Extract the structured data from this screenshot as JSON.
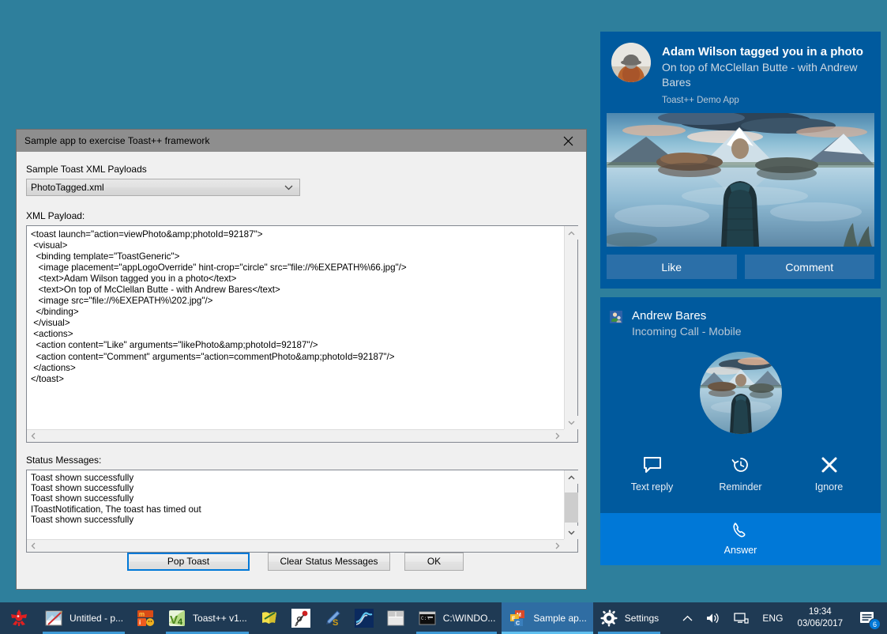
{
  "desktop": {
    "background": "#2e7f9c"
  },
  "dialog": {
    "title": "Sample app to exercise Toast++ framework",
    "close_icon": "close-icon",
    "payload_label": "Sample Toast XML Payloads",
    "combo_value": "PhotoTagged.xml",
    "combo_options": [
      "PhotoTagged.xml"
    ],
    "xml_label": "XML Payload:",
    "xml_payload": "<toast launch=\"action=viewPhoto&amp;photoId=92187\">\n <visual>\n  <binding template=\"ToastGeneric\">\n   <image placement=\"appLogoOverride\" hint-crop=\"circle\" src=\"file://%EXEPATH%\\66.jpg\"/>\n   <text>Adam Wilson tagged you in a photo</text>\n   <text>On top of McClellan Butte - with Andrew Bares</text>\n   <image src=\"file://%EXEPATH%\\202.jpg\"/>\n  </binding>\n </visual>\n <actions>\n  <action content=\"Like\" arguments=\"likePhoto&amp;photoId=92187\"/>\n  <action content=\"Comment\" arguments=\"action=commentPhoto&amp;photoId=92187\"/>\n </actions>\n</toast>",
    "status_label": "Status Messages:",
    "status_messages": "Toast shown successfully\nToast shown successfully\nToast shown successfully\nIToastNotification, The toast has timed out\nToast shown successfully",
    "buttons": {
      "pop_toast": "Pop Toast",
      "clear_status": "Clear Status Messages",
      "ok": "OK"
    }
  },
  "toast_photo": {
    "title": "Adam Wilson tagged you in a photo",
    "subtitle": "On top of McClellan Butte - with Andrew Bares",
    "app_name": "Toast++ Demo App",
    "avatar_alt": "profile-photo-hiker",
    "hero_alt": "mountain-lake-photo",
    "actions": [
      {
        "label": "Like"
      },
      {
        "label": "Comment"
      }
    ],
    "accent": "#005a9e"
  },
  "toast_call": {
    "name": "Andrew Bares",
    "status": "Incoming Call - Mobile",
    "app_icon": "contact-icon",
    "avatar_alt": "caller-photo-lake",
    "actions": [
      {
        "label": "Text reply",
        "icon": "message-bubble-icon"
      },
      {
        "label": "Reminder",
        "icon": "clock-back-icon"
      },
      {
        "label": "Ignore",
        "icon": "close-x-icon"
      }
    ],
    "answer": {
      "label": "Answer",
      "icon": "phone-icon"
    },
    "accent": "#005a9e",
    "answer_accent": "#0078d7"
  },
  "taskbar": {
    "start_icon": "start-orb-icon",
    "items": [
      {
        "label": "Untitled - p...",
        "icon": "paint-icon",
        "state": "open"
      },
      {
        "label": "",
        "icon": "mapinfo-icon",
        "state": "none"
      },
      {
        "label": "Toast++ v1...",
        "icon": "visual-studio-icon",
        "state": "open"
      },
      {
        "label": "",
        "icon": "notepadpp-icon",
        "state": "none"
      },
      {
        "label": "",
        "icon": "ruby-icon",
        "state": "none"
      },
      {
        "label": "",
        "icon": "editplus-icon",
        "state": "none"
      },
      {
        "label": "",
        "icon": "matlab-icon",
        "state": "none"
      },
      {
        "label": "",
        "icon": "layout-icon",
        "state": "none"
      },
      {
        "label": "C:\\WINDO...",
        "icon": "console-icon",
        "state": "open"
      },
      {
        "label": "Sample ap...",
        "icon": "mfc-app-icon",
        "state": "active"
      },
      {
        "label": "Settings",
        "icon": "gear-icon",
        "state": "open"
      }
    ],
    "tray": {
      "chevron": "show-hidden-icons-chevron",
      "volume": "volume-icon",
      "network": "network-icon",
      "language": "ENG",
      "time": "19:34",
      "date": "03/06/2017",
      "action_center_icon": "action-center-icon",
      "action_center_badge": "6"
    }
  }
}
